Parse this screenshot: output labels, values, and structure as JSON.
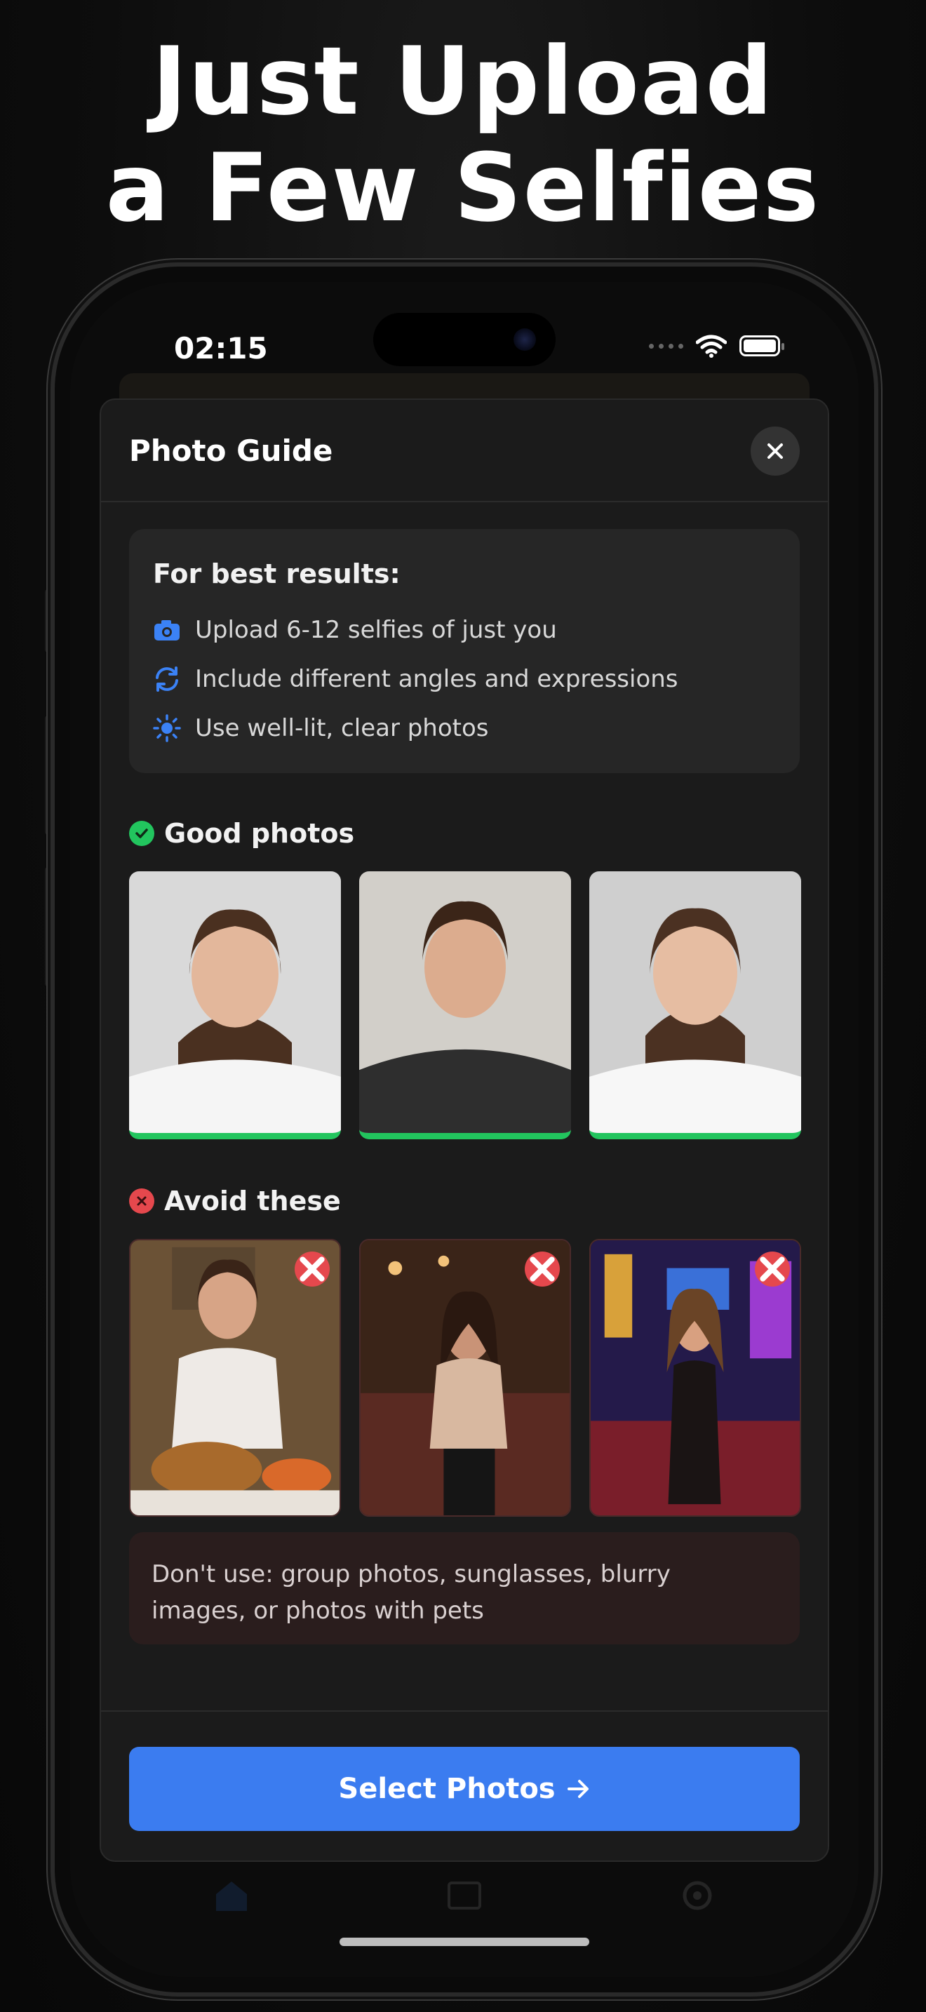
{
  "headline": {
    "line1": "Just Upload",
    "line2": "a Few Selfies"
  },
  "status_bar": {
    "time": "02:15"
  },
  "modal": {
    "title": "Photo Guide",
    "close_icon": "close-icon",
    "tips": {
      "title": "For best results:",
      "items": [
        {
          "icon": "camera-icon",
          "text": "Upload 6-12 selfies of just you"
        },
        {
          "icon": "refresh-icon",
          "text": "Include different angles and expressions"
        },
        {
          "icon": "sun-icon",
          "text": "Use well-lit, clear photos"
        }
      ]
    },
    "good_section": {
      "title": "Good photos",
      "icon": "check-circle-icon"
    },
    "avoid_section": {
      "title": "Avoid these",
      "icon": "x-circle-icon"
    },
    "warning": "Don't use: group photos, sunglasses, blurry images, or photos with pets",
    "cta_label": "Select Photos",
    "cta_icon": "arrow-right-icon"
  },
  "colors": {
    "accent_blue": "#3b7cf0",
    "good_green": "#22c55e",
    "bad_red": "#e5484d",
    "modal_bg": "#1b1b1b",
    "warning_bg": "#2a1d1d"
  }
}
